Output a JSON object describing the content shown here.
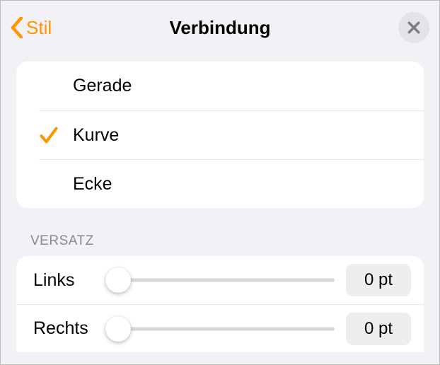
{
  "header": {
    "back_label": "Stil",
    "title": "Verbindung"
  },
  "connection": {
    "options": [
      {
        "label": "Gerade",
        "selected": false
      },
      {
        "label": "Kurve",
        "selected": true
      },
      {
        "label": "Ecke",
        "selected": false
      }
    ]
  },
  "offset": {
    "section_title": "VERSATZ",
    "rows": [
      {
        "label": "Links",
        "value": "0 pt",
        "thumb_pct": 5
      },
      {
        "label": "Rechts",
        "value": "0 pt",
        "thumb_pct": 5
      }
    ]
  }
}
